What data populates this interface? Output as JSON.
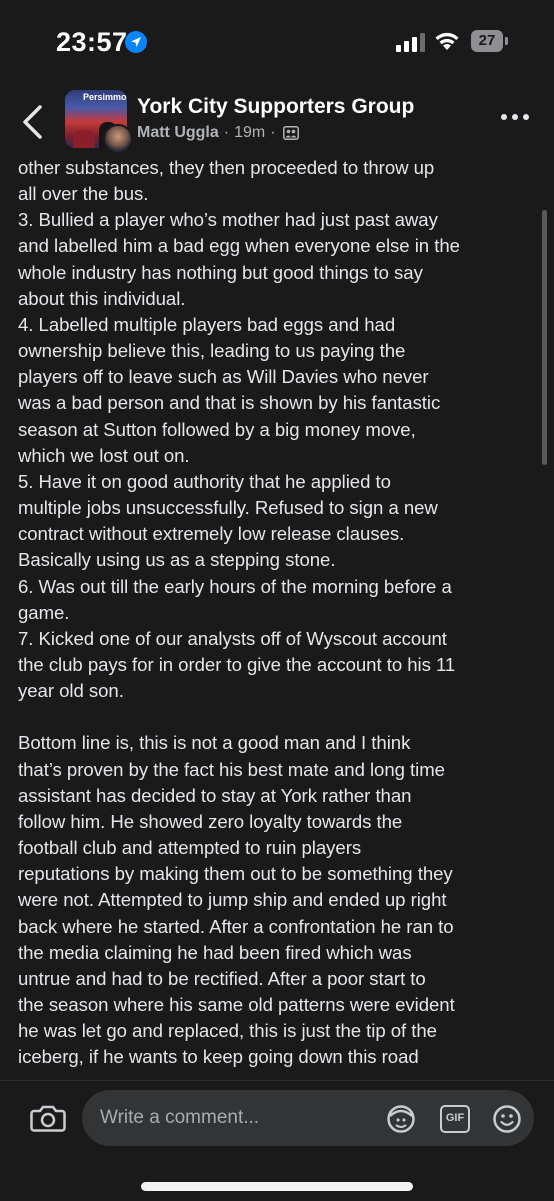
{
  "status_bar": {
    "time": "23:57",
    "battery_level": "27"
  },
  "header": {
    "group_name": "York City Supporters Group",
    "thumb_text": "Persimmon",
    "author": "Matt Uggla",
    "separator": "·",
    "time_ago": "19m",
    "icons": [
      "back-chevron-icon",
      "privacy-group-icon",
      "more-dots-icon"
    ]
  },
  "post": {
    "text": "other substances, they then proceeded to throw up\nall over the bus.\n3. Bullied a player who’s mother had just past away\nand labelled him a bad egg when everyone else in the\nwhole industry has nothing but good things to say\nabout this individual.\n4. Labelled multiple players bad eggs and had\nownership believe this, leading to us paying the\nplayers off to leave such as Will Davies who never\nwas a bad person and that is shown by his fantastic\nseason at Sutton followed by a big money move,\nwhich we lost out on.\n5. Have it on good authority that he applied to\nmultiple jobs unsuccessfully. Refused to sign a new\ncontract without extremely low release clauses.\nBasically using us as a stepping stone.\n6. Was out till the early hours of the morning before a\ngame.\n7. Kicked one of our analysts off of Wyscout account\nthe club pays for in order to give the account to his 11\nyear old son.\n\nBottom line is, this is not a good man and I think\nthat’s proven by the fact his best mate and long time\nassistant has decided to stay at York rather than\nfollow him. He showed zero loyalty towards the\nfootball club and attempted to ruin players\nreputations by making them out to be something they\nwere not. Attempted to jump ship and ended up right\nback where he started. After a confrontation he ran to\nthe media claiming he had been fired which was\nuntrue and had to be rectified. After a poor start to\nthe season where his same old patterns were evident\nhe was let go and replaced, this is just the tip of the\niceberg, if he wants to keep going down this road\nthen I’m happy to bring up more."
  },
  "comment_bar": {
    "placeholder": "Write a comment...",
    "gif_label": "GIF",
    "icons": [
      "camera-icon",
      "avatar-sticker-icon",
      "gif-icon",
      "emoji-icon"
    ]
  },
  "colors": {
    "background": "#1a1a1a",
    "text": "#e4e6eb",
    "secondary_text": "#b0b3b8",
    "input_background": "#333436",
    "accent_blue": "#0a84ff"
  }
}
